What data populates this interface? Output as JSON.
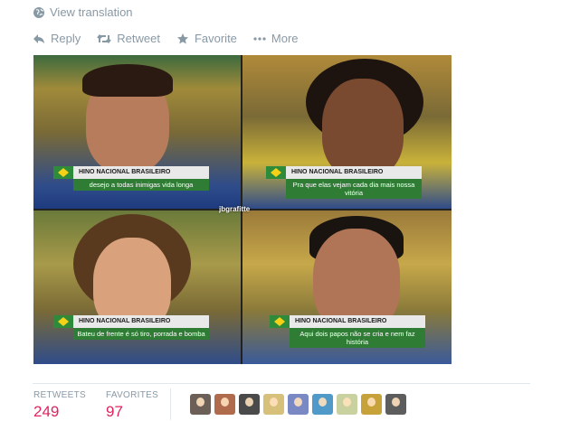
{
  "translation": {
    "label": "View translation"
  },
  "actions": [
    {
      "label": "Reply",
      "icon": "reply-icon"
    },
    {
      "label": "Retweet",
      "icon": "retweet-icon"
    },
    {
      "label": "Favorite",
      "icon": "star-icon"
    },
    {
      "label": "More",
      "icon": "more-dots-icon"
    }
  ],
  "media": {
    "watermark": "jbgrafitte",
    "panels": [
      {
        "header": "HINO NACIONAL BRASILEIRO",
        "caption": "desejo a todas inimigas vida longa"
      },
      {
        "header": "HINO NACIONAL BRASILEIRO",
        "caption": "Pra que elas vejam cada dia mais nossa vitória"
      },
      {
        "header": "HINO NACIONAL BRASILEIRO",
        "caption": "Bateu de frente é só tiro, porrada e bomba"
      },
      {
        "header": "HINO NACIONAL BRASILEIRO",
        "caption": "Aqui dois papos não se cria e nem faz história"
      }
    ]
  },
  "stats": {
    "retweets": {
      "label": "RETWEETS",
      "value": "249"
    },
    "favorites": {
      "label": "FAVORITES",
      "value": "97"
    }
  },
  "colors": {
    "counts": "#e0245e",
    "muted": "#8899a6",
    "caption_bg": "#2f7d35"
  },
  "avatars": [
    {
      "tint": "#6b5f57"
    },
    {
      "tint": "#b06a4c"
    },
    {
      "tint": "#4a4a4a"
    },
    {
      "tint": "#d6c07a"
    },
    {
      "tint": "#7a88c4"
    },
    {
      "tint": "#4f9ac8"
    },
    {
      "tint": "#c9d1a0"
    },
    {
      "tint": "#c7a13a"
    },
    {
      "tint": "#5d5d5d"
    }
  ]
}
